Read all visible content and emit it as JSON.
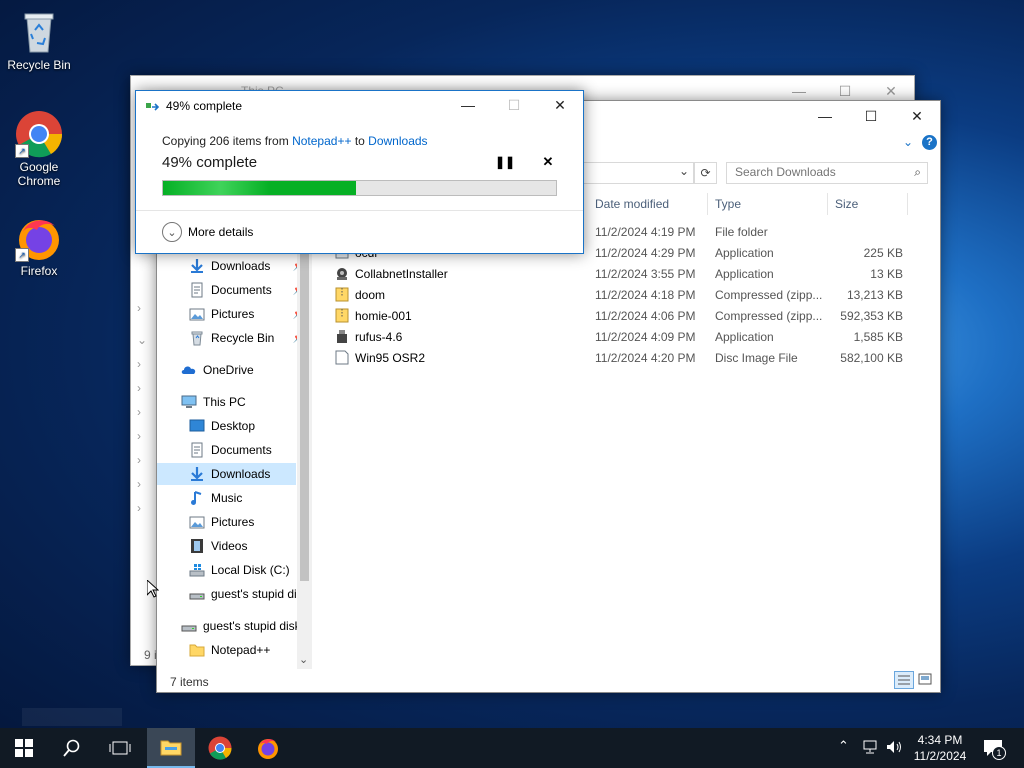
{
  "desktop": {
    "icons": [
      {
        "label": "Recycle Bin"
      },
      {
        "label": "Google Chrome"
      },
      {
        "label": "Firefox"
      }
    ]
  },
  "back_window": {
    "title": "This PC",
    "status": "9 i"
  },
  "explorer": {
    "search_placeholder": "Search Downloads",
    "columns": {
      "date": "Date modified",
      "type": "Type",
      "size": "Size"
    },
    "nav": {
      "quick": [
        {
          "label": "Downloads",
          "pinned": true
        },
        {
          "label": "Documents",
          "pinned": true
        },
        {
          "label": "Pictures",
          "pinned": true
        },
        {
          "label": "Recycle Bin",
          "pinned": true
        }
      ],
      "onedrive": "OneDrive",
      "thispc": "This PC",
      "pc_children": [
        "Desktop",
        "Documents",
        "Downloads",
        "Music",
        "Pictures",
        "Videos",
        "Local Disk (C:)",
        "guest's stupid di"
      ],
      "extra": [
        "guest's stupid disk",
        "Notepad++"
      ]
    },
    "files": [
      {
        "name": "",
        "date": "11/2/2024 4:19 PM",
        "type": "File folder",
        "size": "",
        "icon": "folder-icon"
      },
      {
        "name": "ocdr",
        "date": "11/2/2024 4:29 PM",
        "type": "Application",
        "size": "225 KB",
        "icon": "app-icon"
      },
      {
        "name": "CollabnetInstaller",
        "date": "11/2/2024 3:55 PM",
        "type": "Application",
        "size": "13 KB",
        "icon": "installer-icon"
      },
      {
        "name": "doom",
        "date": "11/2/2024 4:18 PM",
        "type": "Compressed (zipp...",
        "size": "13,213 KB",
        "icon": "zip-icon"
      },
      {
        "name": "homie-001",
        "date": "11/2/2024 4:06 PM",
        "type": "Compressed (zipp...",
        "size": "592,353 KB",
        "icon": "zip-icon"
      },
      {
        "name": "rufus-4.6",
        "date": "11/2/2024 4:09 PM",
        "type": "Application",
        "size": "1,585 KB",
        "icon": "usb-app-icon"
      },
      {
        "name": "Win95 OSR2",
        "date": "11/2/2024 4:20 PM",
        "type": "Disc Image File",
        "size": "582,100 KB",
        "icon": "disc-image-icon"
      }
    ],
    "status": "7 items"
  },
  "copy_dialog": {
    "title": "49% complete",
    "copy_prefix": "Copying 206 items from",
    "source": "Notepad++",
    "to_word": "to",
    "dest": "Downloads",
    "percent_label": "49% complete",
    "progress": 0.49,
    "more_details": "More details"
  },
  "taskbar": {
    "time": "4:34 PM",
    "date": "11/2/2024",
    "notification_count": "1"
  },
  "colors": {
    "progress": "#06b025",
    "accent": "#0078d7",
    "link": "#0066cc",
    "selected_nav": "#cce8ff"
  }
}
